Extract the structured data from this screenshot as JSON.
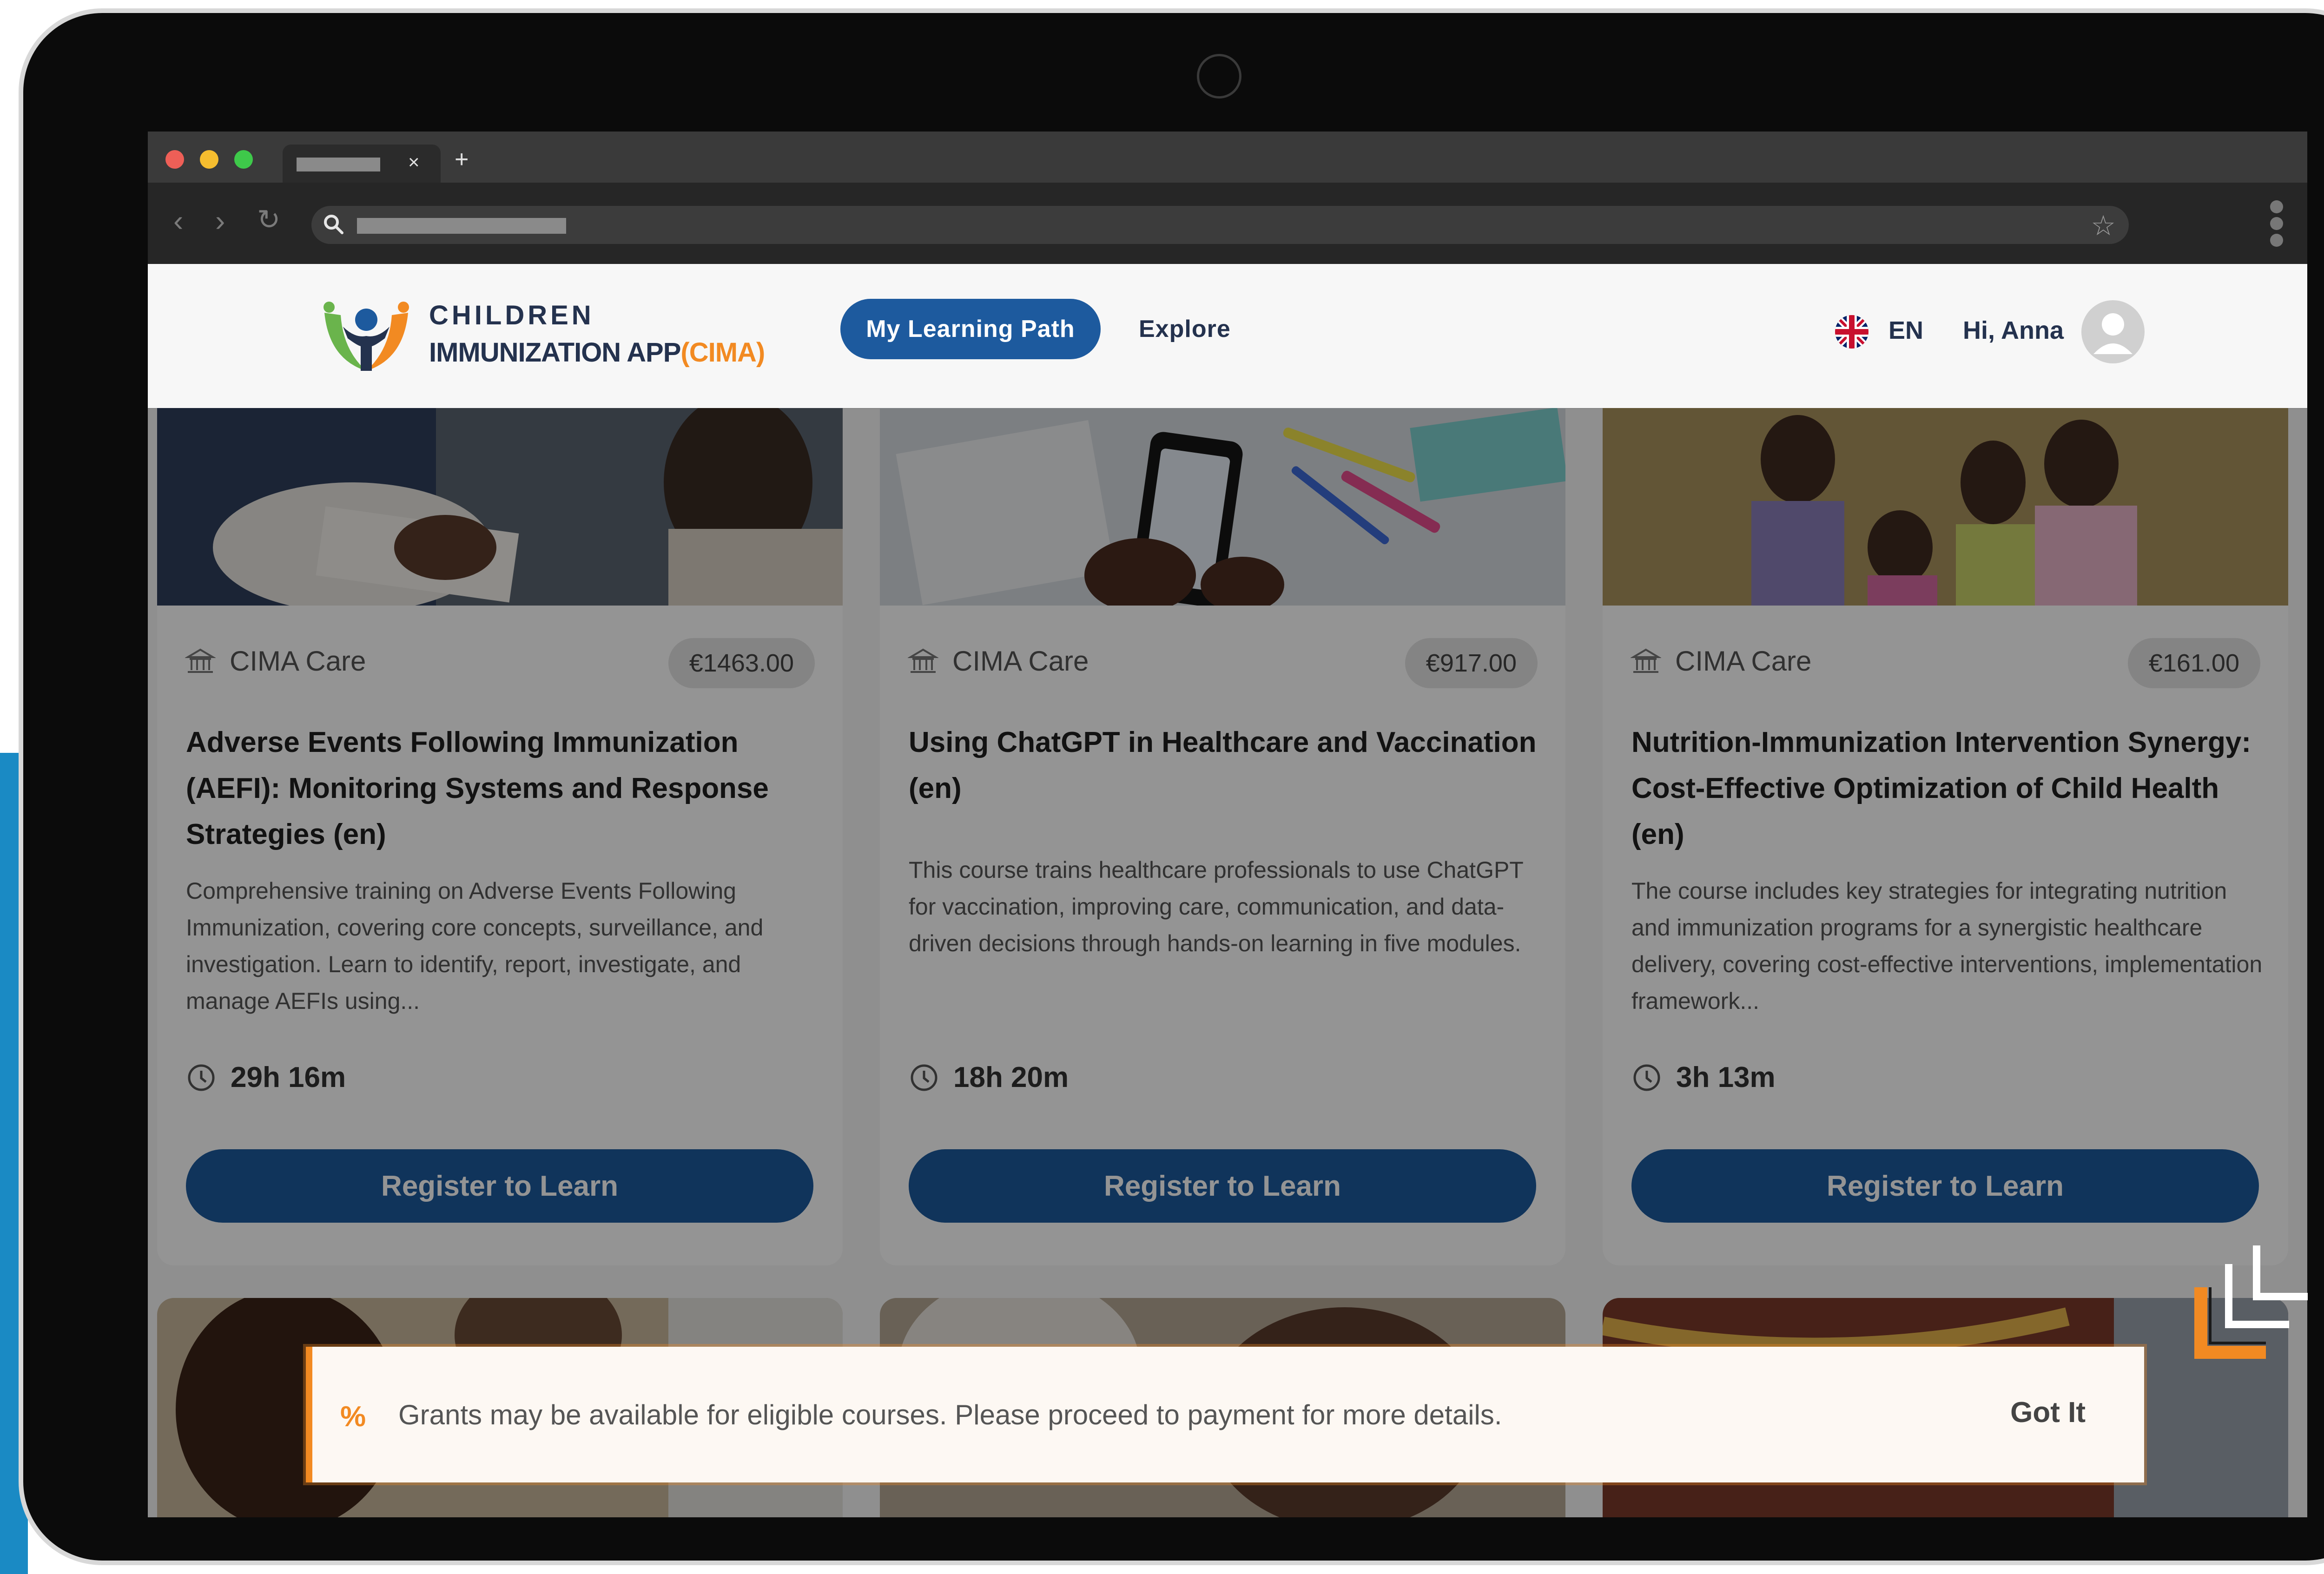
{
  "brand": {
    "name_line1": "CHILDREN",
    "name_line2": "IMMUNIZATION APP",
    "name_accent": "(CIMA)",
    "colors": {
      "primary": "#1d5a9e",
      "accent": "#f28a22",
      "text": "#24324e"
    }
  },
  "header": {
    "nav_active": "My Learning Path",
    "nav_explore": "Explore",
    "language": "EN",
    "greeting": "Hi, Anna"
  },
  "courses": [
    {
      "provider": "CIMA Care",
      "price": "€1463.00",
      "title": "Adverse Events Following Immunization (AEFI): Monitoring Systems and Response Strategies (en)",
      "description": "Comprehensive training on Adverse Events Following Immunization, covering core concepts, surveillance, and investigation. Learn to identify, report, investigate, and manage AEFIs using...",
      "duration": "29h 16m",
      "cta": "Register to Learn"
    },
    {
      "provider": "CIMA Care",
      "price": "€917.00",
      "title": "Using ChatGPT in Healthcare and Vaccination (en)",
      "description": "This course trains healthcare professionals to use ChatGPT for vaccination, improving care, communication, and data-driven decisions through hands-on learning in five modules.",
      "duration": "18h 20m",
      "cta": "Register to Learn"
    },
    {
      "provider": "CIMA Care",
      "price": "€161.00",
      "title": "Nutrition-Immunization Intervention Synergy: Cost-Effective Optimization of Child Health (en)",
      "description": "The course includes key strategies for integrating nutrition and immunization programs for a synergistic healthcare delivery, covering cost-effective interventions, implementation framework...",
      "duration": "3h 13m",
      "cta": "Register to Learn"
    }
  ],
  "toast": {
    "icon": "percent-icon",
    "message": "Grants may be available for eligible courses. Please proceed to payment for more details.",
    "action": "Got It"
  },
  "icons": {
    "provider": "institution-icon",
    "duration": "clock-icon",
    "collapse": "collapse-arrow-icon",
    "flag": "uk-flag-icon"
  }
}
